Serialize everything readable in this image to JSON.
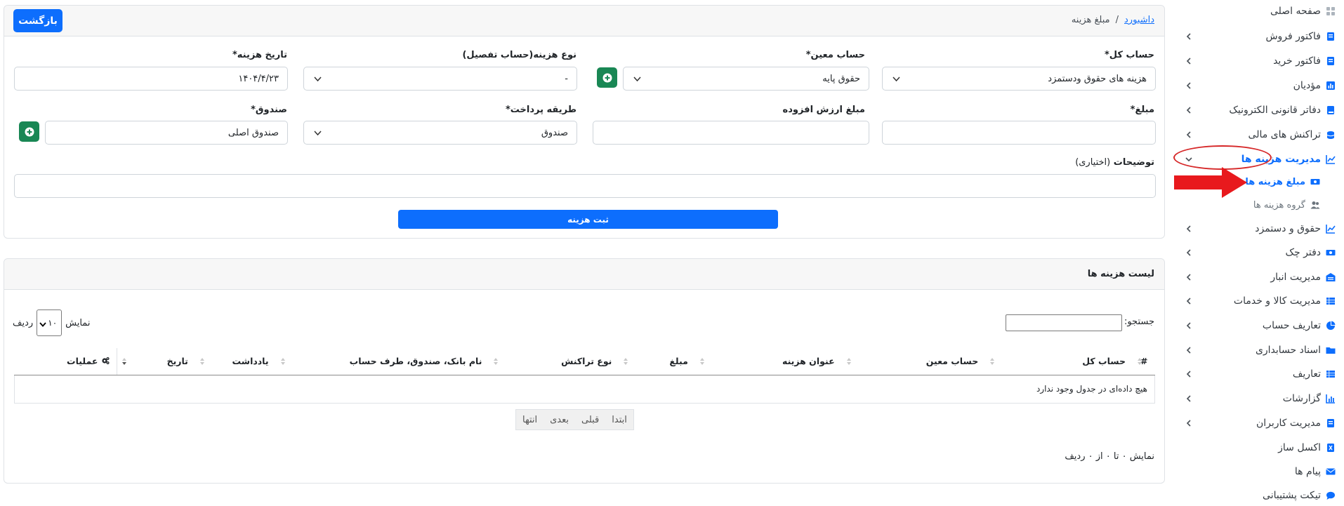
{
  "sidebar": {
    "items": [
      {
        "label": "صفحه اصلی",
        "icon": "grid-icon",
        "chev": false
      },
      {
        "label": "فاکتور فروش",
        "icon": "document-icon",
        "chev": true
      },
      {
        "label": "فاکتور خرید",
        "icon": "document-icon",
        "chev": true
      },
      {
        "label": "مؤدیان",
        "icon": "bar-chart-icon",
        "chev": true
      },
      {
        "label": "دفاتر قانونی الکترونیک",
        "icon": "book-icon",
        "chev": true
      },
      {
        "label": "تراکنش های مالی",
        "icon": "coins-icon",
        "chev": true
      },
      {
        "label": "مدیریت هزینه ها",
        "icon": "chart-line-icon",
        "chev": true
      },
      {
        "label": "مبلغ هزینه ها",
        "icon": "money-bill-icon",
        "chev": false
      },
      {
        "label": "گروه هزینه ها",
        "icon": "users-icon",
        "chev": false
      },
      {
        "label": "حقوق و دستمزد",
        "icon": "chart-line-icon",
        "chev": true
      },
      {
        "label": "دفتر چک",
        "icon": "money-bill-icon",
        "chev": true
      },
      {
        "label": "مدیریت انبار",
        "icon": "warehouse-icon",
        "chev": true
      },
      {
        "label": "مدیریت کالا و خدمات",
        "icon": "list-icon",
        "chev": true
      },
      {
        "label": "تعاریف حساب",
        "icon": "pie-chart-icon",
        "chev": true
      },
      {
        "label": "اسناد حسابداری",
        "icon": "folder-icon",
        "chev": true
      },
      {
        "label": "تعاریف",
        "icon": "list-icon",
        "chev": true
      },
      {
        "label": "گزارشات",
        "icon": "bar-chart-icon",
        "chev": true
      },
      {
        "label": "مدیریت کاربران",
        "icon": "document-icon",
        "chev": true
      },
      {
        "label": "اکسل ساز",
        "icon": "document-icon",
        "chev": false
      },
      {
        "label": "پیام ها",
        "icon": "envelope-icon",
        "chev": false
      },
      {
        "label": "تیکت پشتیبانی",
        "icon": "chat-icon",
        "chev": false
      }
    ]
  },
  "header": {
    "breadcrumb_home": "داشبورد",
    "breadcrumb_sep": "/",
    "breadcrumb_current": "مبلغ هزینه",
    "back_button": "بازگشت"
  },
  "form": {
    "general_account_label": "حساب کل*",
    "general_account_value": "هزینه های حقوق ودستمزد",
    "specific_account_label": "حساب معین*",
    "specific_account_value": "حقوق پایه",
    "expense_type_label": "نوع هزینه(حساب تفصیل)",
    "expense_type_value": "-",
    "expense_date_label": "تاریخ هزینه*",
    "expense_date_value": "۱۴۰۴/۴/۲۳",
    "amount_label": "مبلغ*",
    "amount_value": "",
    "vat_label": "مبلغ ارزش افزوده",
    "vat_value": "",
    "payment_method_label": "طریقه پرداخت*",
    "payment_method_value": "صندوق",
    "cashbox_label": "صندوق*",
    "cashbox_value": "صندوق اصلی",
    "description_label": "توضیحات",
    "description_optional": "(اختیاری)",
    "description_value": "",
    "submit_button": "ثبت هزینه"
  },
  "list": {
    "title": "لیست هزینه ها",
    "search_label": "جستجو:",
    "search_value": "",
    "show_label": "نمایش",
    "page_length": "۱۰",
    "rows_label": "ردیف",
    "columns": [
      "#",
      "حساب کل",
      "حساب معین",
      "عنوان هزینه",
      "مبلغ",
      "نوع تراکنش",
      "نام بانک، صندوق، طرف حساب",
      "یادداشت",
      "تاریخ",
      "عملیات"
    ],
    "empty_message": "هیچ داده‌ای در جدول وجود ندارد",
    "pager": [
      "ابتدا",
      "قبلی",
      "بعدی",
      "انتها"
    ],
    "info": "نمایش ۰ تا ۰ از ۰ ردیف"
  },
  "colors": {
    "primary": "#0d6efd",
    "success": "#198754",
    "annotation": "#d62728"
  }
}
